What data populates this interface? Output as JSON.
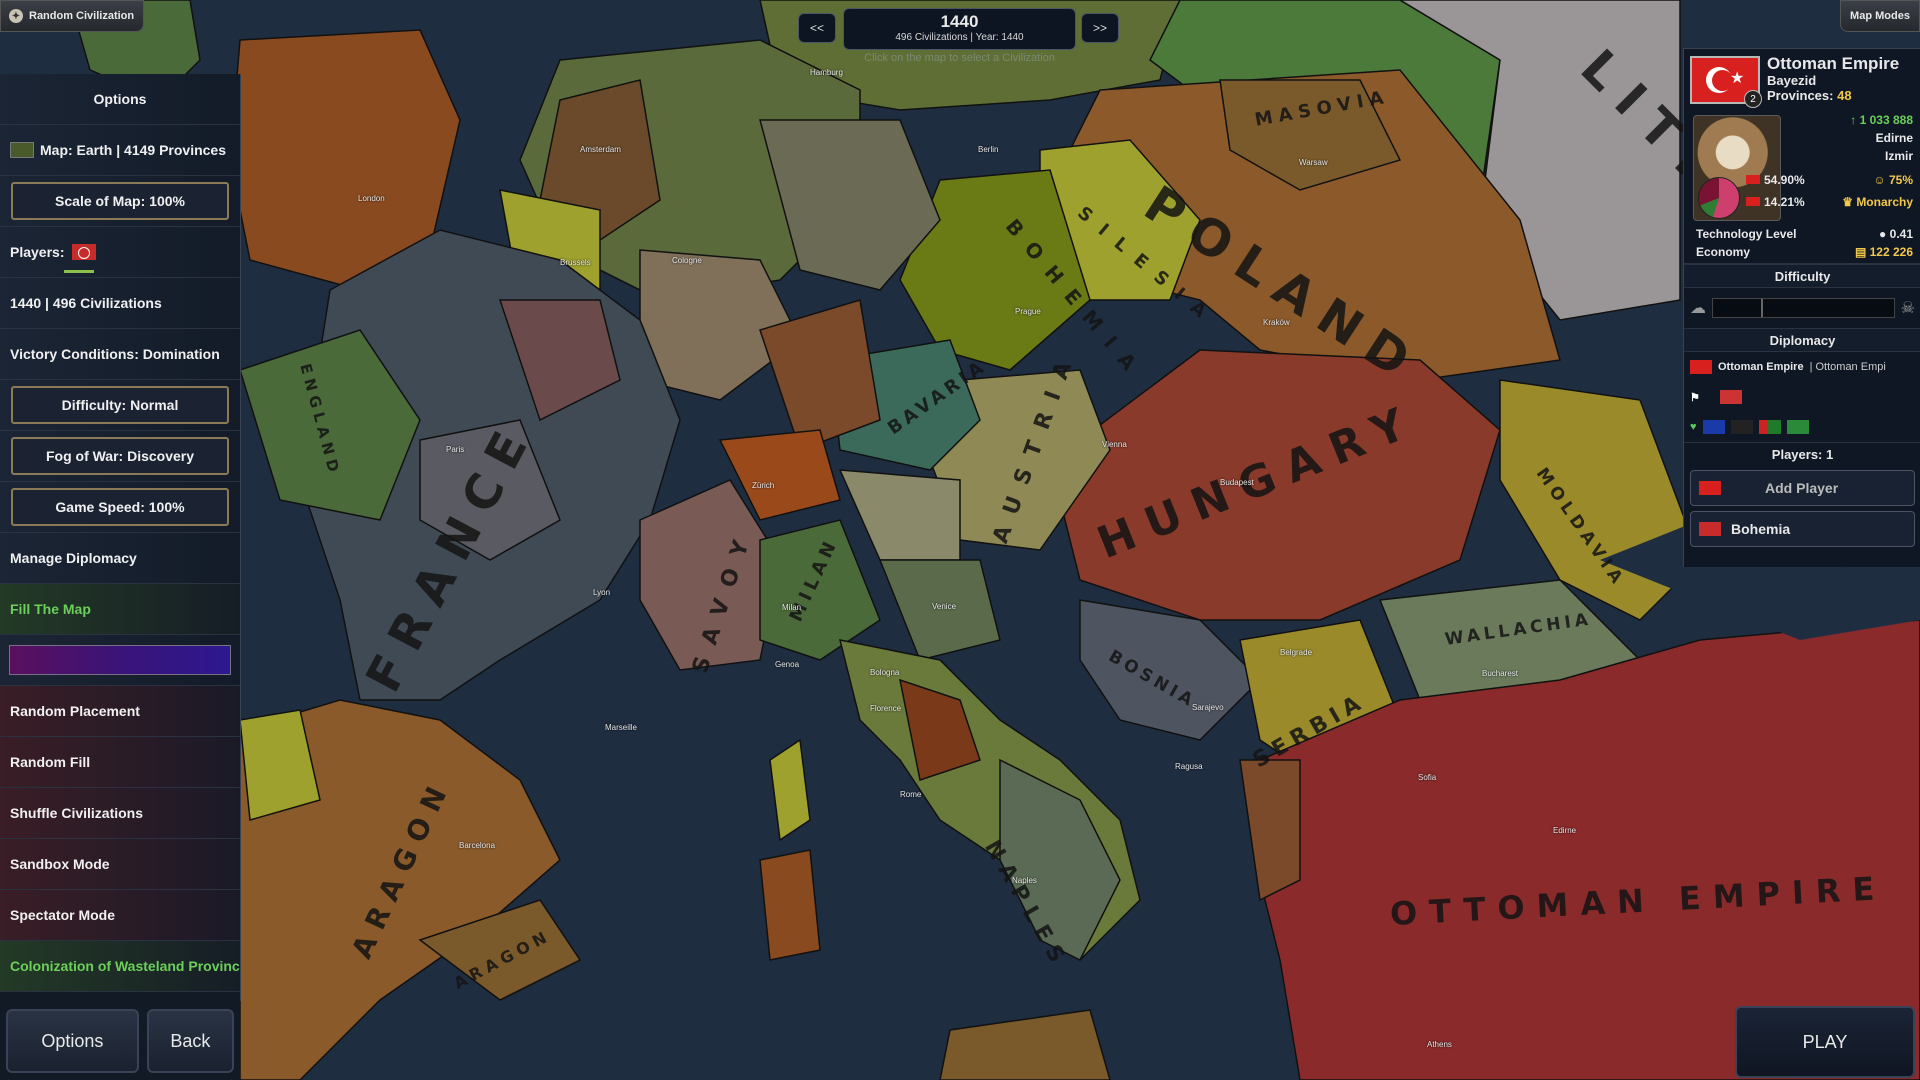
{
  "app": {
    "title": "Random Civilization",
    "map_modes": "Map Modes"
  },
  "timeline": {
    "year": "1440",
    "subtitle": "496 Civilizations | Year: 1440",
    "prev": "<<",
    "next": ">>",
    "hint": "Click on the map to select a Civilization"
  },
  "left_panel": {
    "options_title": "Options",
    "map": "Map: Earth | 4149 Provinces",
    "scale": "Scale of Map: 100%",
    "players": "Players:",
    "year_civs": "1440 | 496 Civilizations",
    "victory": "Victory Conditions: Domination",
    "difficulty": "Difficulty: Normal",
    "fog": "Fog of War: Discovery",
    "speed": "Game Speed: 100%",
    "manage_diplomacy": "Manage Diplomacy",
    "fill_map": "Fill The Map",
    "random_placement": "Random Placement",
    "random_fill": "Random Fill",
    "shuffle": "Shuffle Civilizations",
    "sandbox": "Sandbox Mode",
    "spectator": "Spectator Mode",
    "colonization": "Colonization of Wasteland Provinces",
    "options_btn": "Options",
    "back_btn": "Back"
  },
  "civ": {
    "name": "Ottoman Empire",
    "leader": "Bayezid",
    "provinces_label": "Provinces:",
    "provinces": "48",
    "rank": "2",
    "population": "1 033 888",
    "capital": "Edirne",
    "city2": "Izmir",
    "pct1": "54.90%",
    "pct2": "14.21%",
    "happiness": "75%",
    "government": "Monarchy",
    "tech_label": "Technology Level",
    "tech_value": "0.41",
    "economy_label": "Economy",
    "economy_value": "122 226"
  },
  "right_panel": {
    "difficulty": "Difficulty",
    "diplomacy": "Diplomacy",
    "dip_civ": "Ottoman Empire",
    "dip_civ_sub": "| Ottoman Empi",
    "players": "Players: 1",
    "add_player": "Add Player",
    "player1": "Bohemia"
  },
  "play": "PLAY",
  "countries": [
    "POLAND",
    "HUNGARY",
    "FRANCE",
    "BOHEMIA",
    "AUSTRIA",
    "SAVOY",
    "SILESIA",
    "MASOVIA",
    "BAVARIA",
    "BOSNIA",
    "SERBIA",
    "WALLACHIA",
    "MOLDAVIA",
    "NAPLES",
    "ARAGON",
    "OTTOMAN EMPIRE",
    "ENGLAND",
    "MILAN",
    "LITHU",
    "ARAGON"
  ],
  "cities": [
    "London",
    "Paris",
    "Prague",
    "Vienna",
    "Kraków",
    "Budapest",
    "Milan",
    "Venice",
    "Florence",
    "Naples",
    "Rome",
    "Barcelona",
    "Marseille",
    "Lyon",
    "Edirne",
    "Athens",
    "Sofia",
    "Bucharest",
    "Warsaw",
    "Berlin",
    "Hamburg",
    "Cologne",
    "Brussels",
    "Amsterdam",
    "Zürich",
    "Genoa",
    "Bologna",
    "Ragusa",
    "Belgrade",
    "Sarajevo"
  ]
}
